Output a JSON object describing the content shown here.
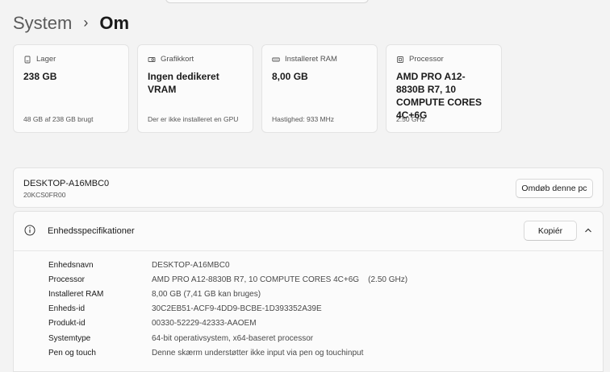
{
  "breadcrumb": {
    "parent": "System",
    "separator": "›",
    "current": "Om"
  },
  "cards": [
    {
      "icon": "storage-icon",
      "title": "Lager",
      "value": "238 GB",
      "sub": "48 GB af 238 GB brugt"
    },
    {
      "icon": "graphics-card-icon",
      "title": "Grafikkort",
      "value": "Ingen dedikeret VRAM",
      "sub": "Der er ikke installeret en GPU"
    },
    {
      "icon": "ram-icon",
      "title": "Installeret RAM",
      "value": "8,00 GB",
      "sub": "Hastighed: 933 MHz"
    },
    {
      "icon": "processor-icon",
      "title": "Processor",
      "value": "AMD PRO A12-8830B R7, 10 COMPUTE CORES 4C+6G",
      "sub": "2.50 GHz"
    }
  ],
  "device": {
    "name": "DESKTOP-A16MBC0",
    "model": "20KCS0FR00",
    "rename_label": "Omdøb denne pc"
  },
  "specs": {
    "title": "Enhedsspecifikationer",
    "copy_label": "Kopiér",
    "rows": [
      {
        "label": "Enhedsnavn",
        "value": "DESKTOP-A16MBC0"
      },
      {
        "label": "Processor",
        "value": "AMD PRO A12-8830B R7, 10 COMPUTE CORES 4C+6G    (2.50 GHz)"
      },
      {
        "label": "Installeret RAM",
        "value": "8,00 GB (7,41 GB kan bruges)"
      },
      {
        "label": "Enheds-id",
        "value": "30C2EB51-ACF9-4DD9-BCBE-1D393352A39E"
      },
      {
        "label": "Produkt-id",
        "value": "00330-52229-42333-AAOEM"
      },
      {
        "label": "Systemtype",
        "value": "64-bit operativsystem, x64-baseret processor"
      },
      {
        "label": "Pen og touch",
        "value": "Denne skærm understøtter ikke input via pen og touchinput"
      }
    ]
  }
}
